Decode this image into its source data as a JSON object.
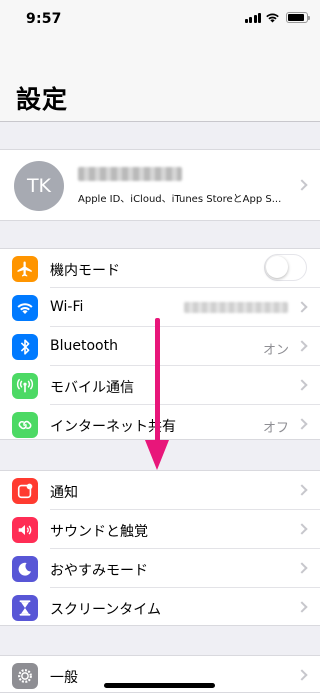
{
  "status_bar": {
    "time": "9:57"
  },
  "header": {
    "title": "設定"
  },
  "profile": {
    "initials": "TK",
    "subtitle": "Apple ID、iCloud、iTunes StoreとApp S..."
  },
  "group1": [
    {
      "label": "機内モード",
      "icon": "airplane-icon",
      "color": "#ff9500",
      "accessory": "toggle",
      "toggle_on": false
    },
    {
      "label": "Wi-Fi",
      "icon": "wifi-icon",
      "color": "#007aff",
      "accessory": "blurred-value"
    },
    {
      "label": "Bluetooth",
      "icon": "bluetooth-icon",
      "color": "#007aff",
      "value": "オン"
    },
    {
      "label": "モバイル通信",
      "icon": "antenna-icon",
      "color": "#4cd964"
    },
    {
      "label": "インターネット共有",
      "icon": "hotspot-icon",
      "color": "#4cd964",
      "value": "オフ"
    }
  ],
  "group2": [
    {
      "label": "通知",
      "icon": "notification-icon",
      "color": "#ff3b30"
    },
    {
      "label": "サウンドと触覚",
      "icon": "speaker-icon",
      "color": "#ff2d55"
    },
    {
      "label": "おやすみモード",
      "icon": "moon-icon",
      "color": "#5856d6"
    },
    {
      "label": "スクリーンタイム",
      "icon": "hourglass-icon",
      "color": "#5856d6"
    }
  ],
  "group3": [
    {
      "label": "一般",
      "icon": "gear-icon",
      "color": "#8e8e93"
    }
  ],
  "annotation": {
    "arrow_color": "#e8167a"
  }
}
